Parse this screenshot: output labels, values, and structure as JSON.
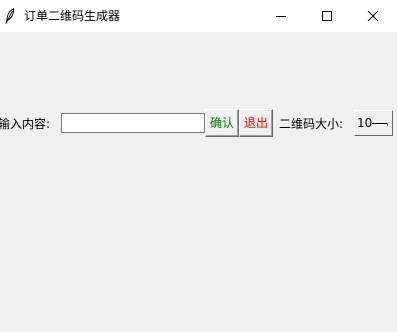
{
  "window": {
    "title": "订单二维码生成器",
    "icons": {
      "app": "feather-icon",
      "minimize": "minimize-icon",
      "maximize": "maximize-icon",
      "close": "close-icon"
    }
  },
  "form": {
    "input_label": "输入内容:",
    "input_value": "",
    "input_placeholder": "",
    "confirm_label": "确认",
    "exit_label": "退出",
    "size_label": "二维码大小:",
    "size_value": "10"
  },
  "colors": {
    "confirm_text": "#008000",
    "exit_text": "#ff0000",
    "background": "#f0f0f0",
    "titlebar": "#ffffff"
  }
}
